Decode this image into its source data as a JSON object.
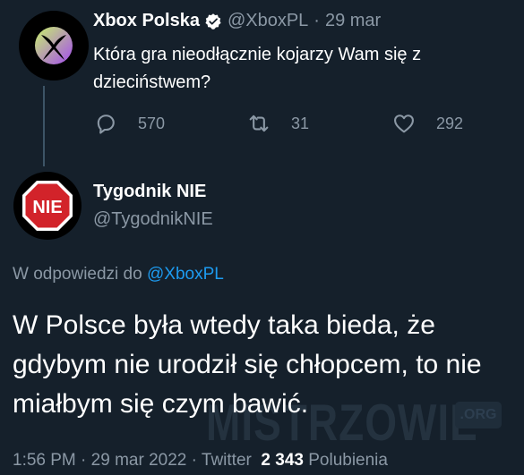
{
  "tweet": {
    "author_name": "Xbox Polska",
    "handle": "@XboxPL",
    "separator": "·",
    "date": "29 mar",
    "text": "Która gra nieodłącznie kojarzy Wam się z dzieciństwem?",
    "replies": "570",
    "retweets": "31",
    "likes": "292"
  },
  "reply": {
    "author_name": "Tygodnik NIE",
    "handle": "@TygodnikNIE",
    "avatar_text": "NIE",
    "reply_to_prefix": "W odpowiedzi do",
    "reply_to_handle": "@XboxPL",
    "text": "W Polsce była wtedy taka bieda, że gdybym nie urodził się chłopcem, to nie miałbym się czym bawić.",
    "time": "1:56 PM",
    "date": "29 mar 2022",
    "source": "Twitter",
    "separator": "·",
    "likes_count": "2 343",
    "likes_label": "Polubienia"
  },
  "watermark": {
    "text": "MISTRZOWIE",
    "badge": ".ORG"
  },
  "colors": {
    "background": "#15202b",
    "muted": "#8b98a5",
    "link": "#1d9bf0",
    "stop_sign": "#d2232a"
  }
}
